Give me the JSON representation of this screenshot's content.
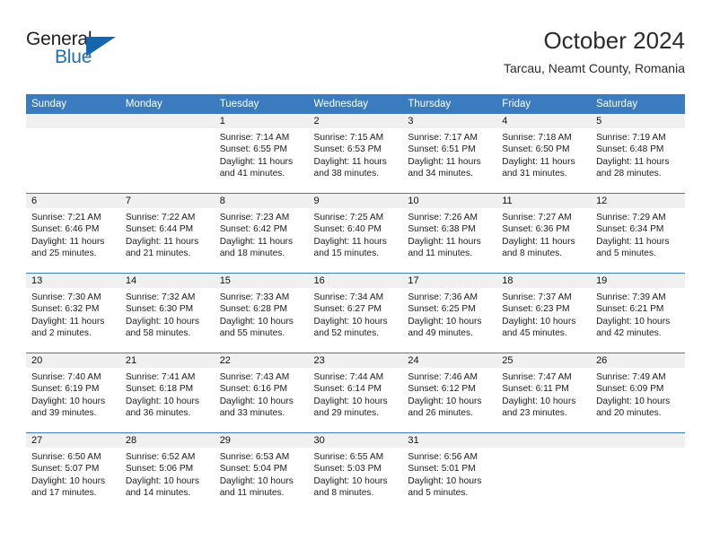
{
  "brand": {
    "name_top": "General",
    "name_bottom": "Blue",
    "triangle_icon": "triangle-icon",
    "accent_color": "#1567ac"
  },
  "header": {
    "month_title": "October 2024",
    "location": "Tarcau, Neamt County, Romania"
  },
  "calendar": {
    "header_bg": "#3a7cbf",
    "daynum_bg": "#f0f0f0",
    "weekdays": [
      "Sunday",
      "Monday",
      "Tuesday",
      "Wednesday",
      "Thursday",
      "Friday",
      "Saturday"
    ],
    "weeks": [
      [
        {
          "day": "",
          "lines": []
        },
        {
          "day": "",
          "lines": []
        },
        {
          "day": "1",
          "lines": [
            "Sunrise: 7:14 AM",
            "Sunset: 6:55 PM",
            "Daylight: 11 hours",
            "and 41 minutes."
          ]
        },
        {
          "day": "2",
          "lines": [
            "Sunrise: 7:15 AM",
            "Sunset: 6:53 PM",
            "Daylight: 11 hours",
            "and 38 minutes."
          ]
        },
        {
          "day": "3",
          "lines": [
            "Sunrise: 7:17 AM",
            "Sunset: 6:51 PM",
            "Daylight: 11 hours",
            "and 34 minutes."
          ]
        },
        {
          "day": "4",
          "lines": [
            "Sunrise: 7:18 AM",
            "Sunset: 6:50 PM",
            "Daylight: 11 hours",
            "and 31 minutes."
          ]
        },
        {
          "day": "5",
          "lines": [
            "Sunrise: 7:19 AM",
            "Sunset: 6:48 PM",
            "Daylight: 11 hours",
            "and 28 minutes."
          ]
        }
      ],
      [
        {
          "day": "6",
          "lines": [
            "Sunrise: 7:21 AM",
            "Sunset: 6:46 PM",
            "Daylight: 11 hours",
            "and 25 minutes."
          ]
        },
        {
          "day": "7",
          "lines": [
            "Sunrise: 7:22 AM",
            "Sunset: 6:44 PM",
            "Daylight: 11 hours",
            "and 21 minutes."
          ]
        },
        {
          "day": "8",
          "lines": [
            "Sunrise: 7:23 AM",
            "Sunset: 6:42 PM",
            "Daylight: 11 hours",
            "and 18 minutes."
          ]
        },
        {
          "day": "9",
          "lines": [
            "Sunrise: 7:25 AM",
            "Sunset: 6:40 PM",
            "Daylight: 11 hours",
            "and 15 minutes."
          ]
        },
        {
          "day": "10",
          "lines": [
            "Sunrise: 7:26 AM",
            "Sunset: 6:38 PM",
            "Daylight: 11 hours",
            "and 11 minutes."
          ]
        },
        {
          "day": "11",
          "lines": [
            "Sunrise: 7:27 AM",
            "Sunset: 6:36 PM",
            "Daylight: 11 hours",
            "and 8 minutes."
          ]
        },
        {
          "day": "12",
          "lines": [
            "Sunrise: 7:29 AM",
            "Sunset: 6:34 PM",
            "Daylight: 11 hours",
            "and 5 minutes."
          ]
        }
      ],
      [
        {
          "day": "13",
          "lines": [
            "Sunrise: 7:30 AM",
            "Sunset: 6:32 PM",
            "Daylight: 11 hours",
            "and 2 minutes."
          ]
        },
        {
          "day": "14",
          "lines": [
            "Sunrise: 7:32 AM",
            "Sunset: 6:30 PM",
            "Daylight: 10 hours",
            "and 58 minutes."
          ]
        },
        {
          "day": "15",
          "lines": [
            "Sunrise: 7:33 AM",
            "Sunset: 6:28 PM",
            "Daylight: 10 hours",
            "and 55 minutes."
          ]
        },
        {
          "day": "16",
          "lines": [
            "Sunrise: 7:34 AM",
            "Sunset: 6:27 PM",
            "Daylight: 10 hours",
            "and 52 minutes."
          ]
        },
        {
          "day": "17",
          "lines": [
            "Sunrise: 7:36 AM",
            "Sunset: 6:25 PM",
            "Daylight: 10 hours",
            "and 49 minutes."
          ]
        },
        {
          "day": "18",
          "lines": [
            "Sunrise: 7:37 AM",
            "Sunset: 6:23 PM",
            "Daylight: 10 hours",
            "and 45 minutes."
          ]
        },
        {
          "day": "19",
          "lines": [
            "Sunrise: 7:39 AM",
            "Sunset: 6:21 PM",
            "Daylight: 10 hours",
            "and 42 minutes."
          ]
        }
      ],
      [
        {
          "day": "20",
          "lines": [
            "Sunrise: 7:40 AM",
            "Sunset: 6:19 PM",
            "Daylight: 10 hours",
            "and 39 minutes."
          ]
        },
        {
          "day": "21",
          "lines": [
            "Sunrise: 7:41 AM",
            "Sunset: 6:18 PM",
            "Daylight: 10 hours",
            "and 36 minutes."
          ]
        },
        {
          "day": "22",
          "lines": [
            "Sunrise: 7:43 AM",
            "Sunset: 6:16 PM",
            "Daylight: 10 hours",
            "and 33 minutes."
          ]
        },
        {
          "day": "23",
          "lines": [
            "Sunrise: 7:44 AM",
            "Sunset: 6:14 PM",
            "Daylight: 10 hours",
            "and 29 minutes."
          ]
        },
        {
          "day": "24",
          "lines": [
            "Sunrise: 7:46 AM",
            "Sunset: 6:12 PM",
            "Daylight: 10 hours",
            "and 26 minutes."
          ]
        },
        {
          "day": "25",
          "lines": [
            "Sunrise: 7:47 AM",
            "Sunset: 6:11 PM",
            "Daylight: 10 hours",
            "and 23 minutes."
          ]
        },
        {
          "day": "26",
          "lines": [
            "Sunrise: 7:49 AM",
            "Sunset: 6:09 PM",
            "Daylight: 10 hours",
            "and 20 minutes."
          ]
        }
      ],
      [
        {
          "day": "27",
          "lines": [
            "Sunrise: 6:50 AM",
            "Sunset: 5:07 PM",
            "Daylight: 10 hours",
            "and 17 minutes."
          ]
        },
        {
          "day": "28",
          "lines": [
            "Sunrise: 6:52 AM",
            "Sunset: 5:06 PM",
            "Daylight: 10 hours",
            "and 14 minutes."
          ]
        },
        {
          "day": "29",
          "lines": [
            "Sunrise: 6:53 AM",
            "Sunset: 5:04 PM",
            "Daylight: 10 hours",
            "and 11 minutes."
          ]
        },
        {
          "day": "30",
          "lines": [
            "Sunrise: 6:55 AM",
            "Sunset: 5:03 PM",
            "Daylight: 10 hours",
            "and 8 minutes."
          ]
        },
        {
          "day": "31",
          "lines": [
            "Sunrise: 6:56 AM",
            "Sunset: 5:01 PM",
            "Daylight: 10 hours",
            "and 5 minutes."
          ]
        },
        {
          "day": "",
          "lines": []
        },
        {
          "day": "",
          "lines": []
        }
      ]
    ]
  }
}
